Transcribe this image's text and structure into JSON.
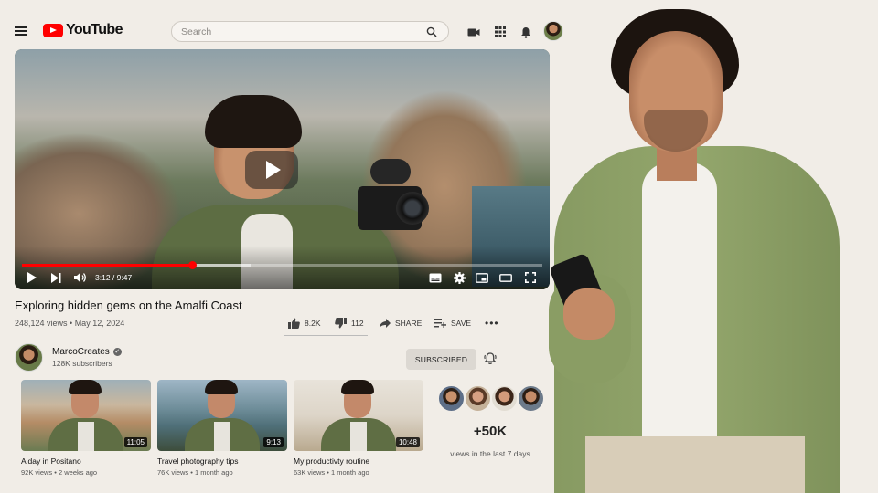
{
  "header": {
    "logo_text": "YouTube",
    "search_placeholder": "Search"
  },
  "player": {
    "timecode": "3:12 / 9:47",
    "progress": 0.327,
    "buffered": 0.44
  },
  "video": {
    "title": "Exploring hidden gems on the Amalfi Coast",
    "meta": "248,124 views • May 12, 2024",
    "likes": "8.2K",
    "dislikes": "112",
    "share_label": "SHARE",
    "save_label": "SAVE"
  },
  "channel": {
    "name": "MarcoCreates",
    "subscribers": "128K subscribers",
    "subscribe_label": "SUBSCRIBED"
  },
  "related": [
    {
      "title": "A day in Positano",
      "meta": "92K views • 2 weeks ago",
      "duration": "11:05"
    },
    {
      "title": "Travel photography tips",
      "meta": "76K views • 1 month ago",
      "duration": "9:13"
    },
    {
      "title": "My productivty routine",
      "meta": "63K views • 1 month ago",
      "duration": "10:48"
    }
  ],
  "stats": {
    "value": "+50K",
    "label": "views in the last 7 days"
  },
  "colors": {
    "brand_red": "#ff0000",
    "background": "#f1ede7"
  },
  "icons": [
    "menu-icon",
    "youtube-logo-icon",
    "search-icon",
    "create-video-icon",
    "apps-grid-icon",
    "notifications-bell-icon",
    "play-icon",
    "next-icon",
    "volume-icon",
    "captions-icon",
    "settings-gear-icon",
    "miniplayer-icon",
    "theater-mode-icon",
    "fullscreen-icon",
    "thumbs-up-icon",
    "thumbs-down-icon",
    "share-arrow-icon",
    "add-to-playlist-icon",
    "more-dots-icon",
    "verified-check-icon",
    "bell-icon"
  ]
}
